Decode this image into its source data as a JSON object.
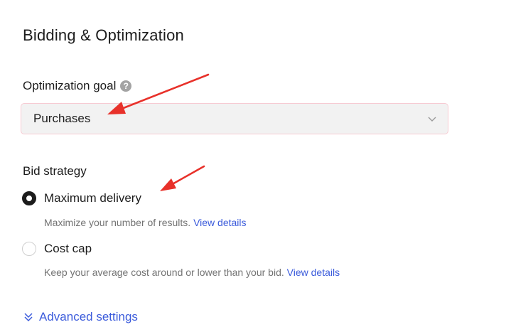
{
  "section": {
    "title": "Bidding & Optimization"
  },
  "optimization": {
    "label": "Optimization goal",
    "help_icon": "question-circle-icon",
    "selected_value": "Purchases",
    "chevron_icon": "chevron-down-icon"
  },
  "bid_strategy": {
    "label": "Bid strategy",
    "options": [
      {
        "label": "Maximum delivery",
        "selected": true,
        "description": "Maximize your number of results.",
        "link": "View details"
      },
      {
        "label": "Cost cap",
        "selected": false,
        "description": "Keep your average cost around or lower than your bid.",
        "link": "View details"
      }
    ]
  },
  "advanced": {
    "icon": "double-chevron-down-icon",
    "label": "Advanced settings"
  },
  "colors": {
    "accent_link": "#3b5bdb",
    "annotation_arrow": "#e8312a",
    "select_border": "#f7cbd3",
    "select_bg": "#f2f2f2"
  }
}
